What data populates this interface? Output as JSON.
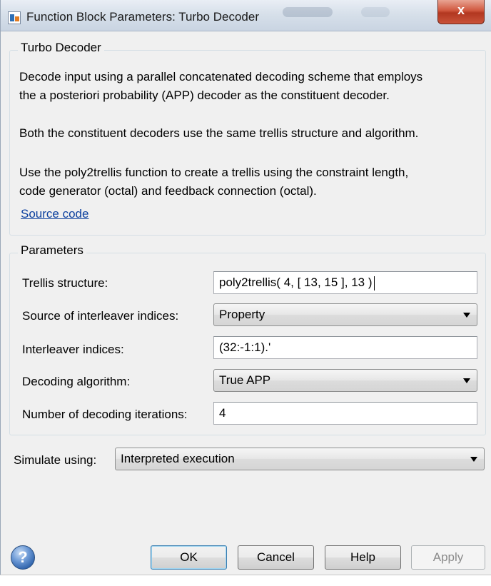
{
  "window": {
    "title": "Function Block Parameters: Turbo Decoder",
    "close_label": "x"
  },
  "description_group": {
    "legend": "Turbo Decoder",
    "lines": [
      "Decode input using a parallel concatenated decoding scheme that employs",
      "the a posteriori probability (APP) decoder as the constituent decoder.",
      "Both the constituent decoders use the same trellis structure and algorithm.",
      "Use the poly2trellis function to create a trellis using the constraint length,",
      "code generator (octal) and feedback connection (octal)."
    ],
    "source_link": "Source code"
  },
  "parameters_group": {
    "legend": "Parameters",
    "trellis_label": "Trellis structure:",
    "trellis_value": "poly2trellis( 4, [ 13, 15 ], 13 )",
    "interleaver_source_label": "Source of interleaver indices:",
    "interleaver_source_value": "Property",
    "interleaver_indices_label": "Interleaver indices:",
    "interleaver_indices_value": "(32:-1:1).'",
    "algorithm_label": "Decoding algorithm:",
    "algorithm_value": "True APP",
    "iterations_label": "Number of decoding iterations:",
    "iterations_value": "4"
  },
  "simulate": {
    "label": "Simulate using:",
    "value": "Interpreted execution"
  },
  "buttons": {
    "help_icon": "?",
    "ok": "OK",
    "cancel": "Cancel",
    "help": "Help",
    "apply": "Apply"
  },
  "icons": {
    "app": "simulink-block-icon",
    "help": "question-circle-icon"
  }
}
